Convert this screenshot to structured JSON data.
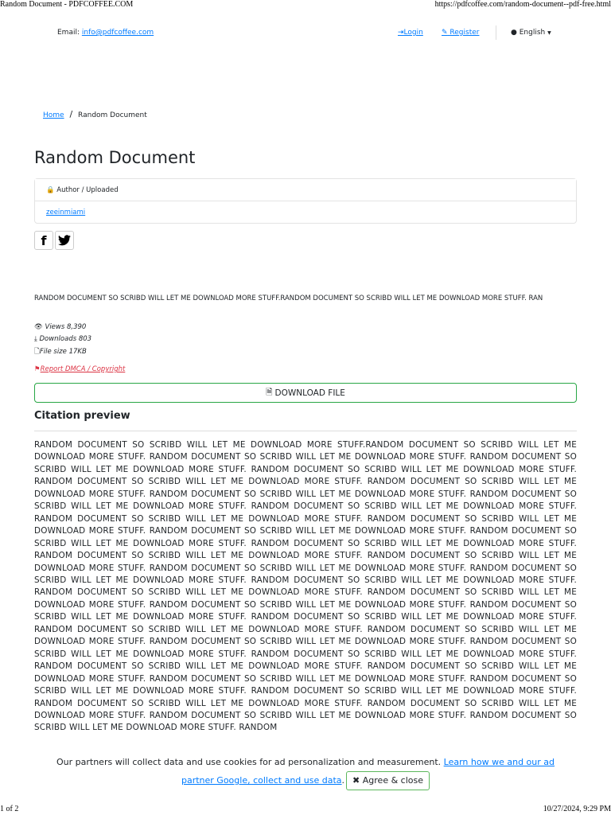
{
  "print_header": {
    "title": "Random Document - PDFCOFFEE.COM",
    "url": "https://pdfcoffee.com/random-document--pdf-free.html"
  },
  "topbar": {
    "email_label": "Email:",
    "email": "info@pdfcoffee.com",
    "login": "Login",
    "register": "Register",
    "language": "English"
  },
  "breadcrumb": {
    "home": "Home",
    "sep": "/",
    "current": "Random Document"
  },
  "title": "Random Document",
  "author_card": {
    "header": "Author / Uploaded",
    "author": "zeeinmiami"
  },
  "social": {
    "facebook": "f",
    "twitter": "t"
  },
  "description": "RANDOM DOCUMENT SO SCRIBD WILL LET ME DOWNLOAD MORE STUFF.RANDOM DOCUMENT SO SCRIBD WILL LET ME DOWNLOAD MORE STUFF. RAN",
  "stats": {
    "views": "Views 8,390",
    "downloads": "Downloads 803",
    "file_size": "File size 17KB"
  },
  "report": "Report DMCA / Copyright",
  "download_button": "DOWNLOAD FILE",
  "citation": {
    "heading": "Citation preview",
    "text": "RANDOM DOCUMENT SO SCRIBD WILL LET ME DOWNLOAD MORE STUFF.RANDOM DOCUMENT SO SCRIBD WILL LET ME DOWNLOAD MORE STUFF. RANDOM DOCUMENT SO SCRIBD WILL LET ME DOWNLOAD MORE STUFF. RANDOM DOCUMENT SO SCRIBD WILL LET ME DOWNLOAD MORE STUFF. RANDOM DOCUMENT SO SCRIBD WILL LET ME DOWNLOAD MORE STUFF. RANDOM DOCUMENT SO SCRIBD WILL LET ME DOWNLOAD MORE STUFF. RANDOM DOCUMENT SO SCRIBD WILL LET ME DOWNLOAD MORE STUFF. RANDOM DOCUMENT SO SCRIBD WILL LET ME DOWNLOAD MORE STUFF. RANDOM DOCUMENT SO SCRIBD WILL LET ME DOWNLOAD MORE STUFF. RANDOM DOCUMENT SO SCRIBD WILL LET ME DOWNLOAD MORE STUFF. RANDOM DOCUMENT SO SCRIBD WILL LET ME DOWNLOAD MORE STUFF. RANDOM DOCUMENT SO SCRIBD WILL LET ME DOWNLOAD MORE STUFF. RANDOM DOCUMENT SO SCRIBD WILL LET ME DOWNLOAD MORE STUFF. RANDOM DOCUMENT SO SCRIBD WILL LET ME DOWNLOAD MORE STUFF. RANDOM DOCUMENT SO SCRIBD WILL LET ME DOWNLOAD MORE STUFF. RANDOM DOCUMENT SO SCRIBD WILL LET ME DOWNLOAD MORE STUFF. RANDOM DOCUMENT SO SCRIBD WILL LET ME DOWNLOAD MORE STUFF. RANDOM DOCUMENT SO SCRIBD WILL LET ME DOWNLOAD MORE STUFF. RANDOM DOCUMENT SO SCRIBD WILL LET ME DOWNLOAD MORE STUFF. RANDOM DOCUMENT SO SCRIBD WILL LET ME DOWNLOAD MORE STUFF. RANDOM DOCUMENT SO SCRIBD WILL LET ME DOWNLOAD MORE STUFF. RANDOM DOCUMENT SO SCRIBD WILL LET ME DOWNLOAD MORE STUFF. RANDOM DOCUMENT SO SCRIBD WILL LET ME DOWNLOAD MORE STUFF. RANDOM DOCUMENT SO SCRIBD WILL LET ME DOWNLOAD MORE STUFF. RANDOM DOCUMENT SO SCRIBD WILL LET ME DOWNLOAD MORE STUFF. RANDOM DOCUMENT SO SCRIBD WILL LET ME DOWNLOAD MORE STUFF. RANDOM DOCUMENT SO SCRIBD WILL LET ME DOWNLOAD MORE STUFF. RANDOM DOCUMENT SO SCRIBD WILL LET ME DOWNLOAD MORE STUFF. RANDOM DOCUMENT SO SCRIBD WILL LET ME DOWNLOAD MORE STUFF. RANDOM DOCUMENT SO SCRIBD WILL LET ME DOWNLOAD MORE STUFF. RANDOM DOCUMENT SO SCRIBD WILL LET ME DOWNLOAD MORE STUFF. RANDOM DOCUMENT SO SCRIBD WILL LET ME DOWNLOAD MORE STUFF. RANDOM DOCUMENT SO SCRIBD WILL LET ME DOWNLOAD MORE STUFF. RANDOM DOCUMENT SO SCRIBD WILL LET ME DOWNLOAD MORE STUFF. RANDOM DOCUMENT SO SCRIBD WILL LET ME DOWNLOAD MORE STUFF. RANDOM DOCUMENT SO SCRIBD WILL LET ME DOWNLOAD MORE STUFF. RANDOM DOCUMENT SO SCRIBD WILL LET ME DOWNLOAD MORE STUFF. RANDOM DOCUMENT SO SCRIBD WILL LET ME DOWNLOAD MORE STUFF. RANDOM DOCUMENT SO SCRIBD WILL LET ME DOWNLOAD MORE STUFF. RANDOM"
  },
  "cookie": {
    "text": "Our partners will collect data and use cookies for ad personalization and measurement. ",
    "link": "Learn how we and our ad partner Google, collect and use data",
    "period": ".",
    "agree": "Agree & close"
  },
  "print_footer": {
    "page": "1 of 2",
    "datetime": "10/27/2024, 9:29 PM"
  },
  "colors": {
    "link": "#007bff",
    "report": "#dc3545",
    "success": "#28a745"
  }
}
